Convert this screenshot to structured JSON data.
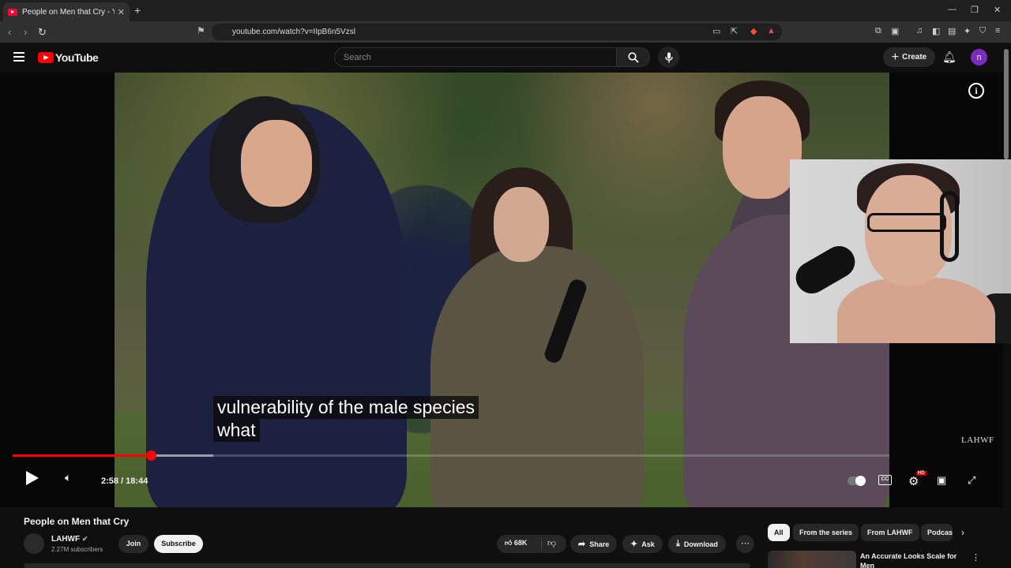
{
  "browser": {
    "tab_title": "People on Men that Cry - YouTube",
    "tab_close": "✕",
    "new_tab": "+",
    "url": "youtube.com/watch?v=IIpB6n5Vzsl",
    "window_controls": [
      "—",
      "❐",
      "✕"
    ]
  },
  "header": {
    "logo_text": "YouTube",
    "search_placeholder": "Search",
    "create_label": "Create",
    "avatar_letter": "n"
  },
  "player": {
    "caption_line1": "vulnerability of the male species",
    "caption_line2": "what",
    "watermark": "LAHWF",
    "time": "2:58 / 18:44",
    "progress_played": 0.158,
    "hd_badge": "HD",
    "cc_label": "CC"
  },
  "video": {
    "title": "People on Men that Cry",
    "channel": "LAHWF",
    "subscribers": "2.27M subscribers",
    "join_label": "Join",
    "subscribe_label": "Subscribe",
    "likes": "68K",
    "share_label": "Share",
    "ask_label": "Ask",
    "download_label": "Download"
  },
  "sidebar": {
    "chips": [
      "All",
      "From the series",
      "From LAHWF",
      "Podcasts"
    ],
    "rec_title": "An Accurate Looks Scale for Men"
  },
  "colors": {
    "accent": "#ff0000",
    "background": "#0f0f0f",
    "avatar": "#7b2cbf"
  }
}
